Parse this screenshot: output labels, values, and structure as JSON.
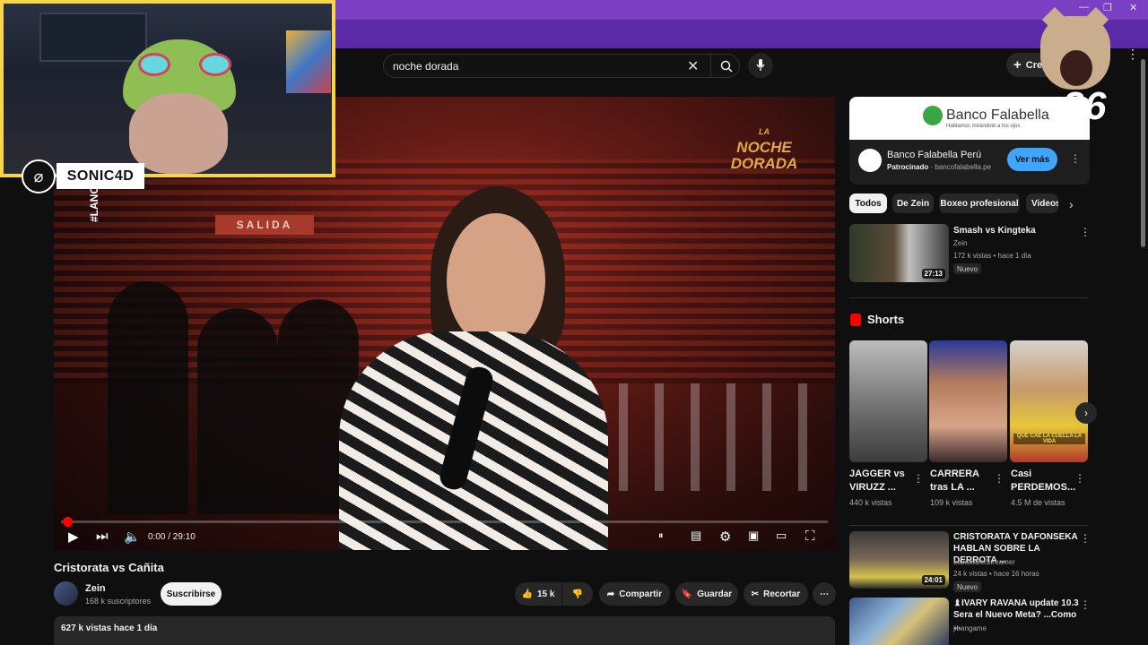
{
  "browser": {
    "minimize": "—",
    "restore": "❐",
    "close": "✕",
    "menu": "⋮"
  },
  "masthead": {
    "search_value": "noche dorada",
    "create_label": "Crear"
  },
  "overlay": {
    "streamer_name": "SONIC4D",
    "reaction_count": "x26"
  },
  "player": {
    "hashtag": "#LANO",
    "exit_sign": "SALIDA",
    "event_logo_line1": "LA",
    "event_logo_line2": "NOCHE",
    "event_logo_line3": "DORADA",
    "time": "0:00 / 29:10",
    "progress": 0.0
  },
  "video": {
    "title": "Cristorata vs Cañita",
    "channel": "Zein",
    "subscribers": "168 k suscriptores",
    "subscribe_label": "Suscribirse",
    "likes": "15 k",
    "share_label": "Compartir",
    "save_label": "Guardar",
    "clip_label": "Recortar",
    "views_date": "627 k vistas  hace 1 día"
  },
  "ad": {
    "brand": "Banco Falabella",
    "tagline": "Hablamos mirándote a los ojos",
    "title": "Banco Falabella Perú",
    "sponsored": "Patrocinado",
    "domain": "bancofalabella.pe",
    "cta": "Ver más"
  },
  "chips": [
    "Todos",
    "De Zein",
    "Boxeo profesional",
    "Videos"
  ],
  "recommendations": [
    {
      "title_line1": "Smash vs Kingteka",
      "title_line2": "",
      "channel": "Zein",
      "meta": "172 k vistas • hace 1 día",
      "badge": "Nuevo",
      "duration": "27:13"
    },
    {
      "title_line1": "CRISTORATA Y DAFONSEKA",
      "title_line2": "HABLAN SOBRE LA DERROTA ...",
      "channel": "LaJatoDelStreamer",
      "meta": "24 k vistas • hace 16 horas",
      "badge": "Nuevo",
      "duration": "24:01"
    },
    {
      "title_line1": "♝IVARY RAVANA update 10.3",
      "title_line2": "Sera el Nuevo Meta? ...Como ...",
      "channel": "jibangame",
      "meta": "",
      "badge": "",
      "duration": ""
    }
  ],
  "shorts": {
    "heading": "Shorts",
    "items": [
      {
        "title_line1": "JAGGER vs",
        "title_line2": "VIRUZZ ...",
        "views": "440 k vistas"
      },
      {
        "title_line1": "CARRERA",
        "title_line2": "tras LA ...",
        "views": "109 k vistas"
      },
      {
        "title_line1": "Casi",
        "title_line2": "PERDEMOS...",
        "views": "4.5 M de vistas"
      }
    ],
    "short3_caption": "QUE CAE LA CUELLA LA VIDA"
  }
}
